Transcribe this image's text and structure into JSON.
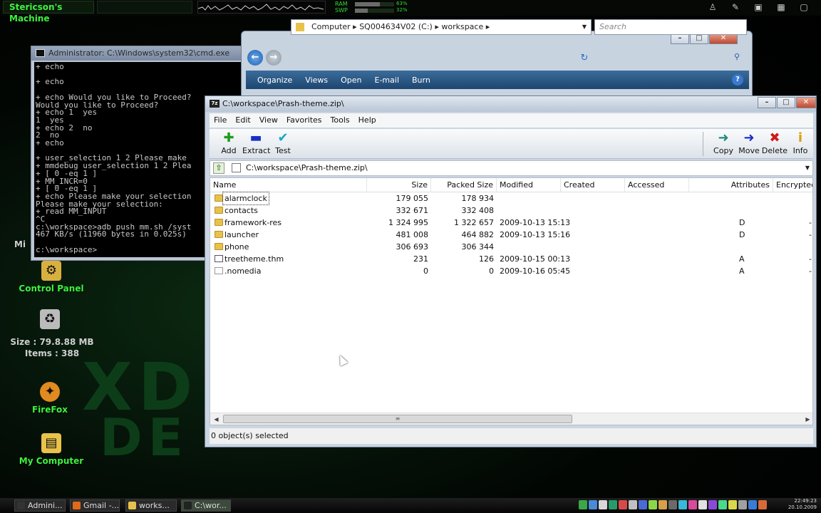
{
  "desktop": {
    "machine_name": "Stericson's Machine",
    "ram_label": "RAM",
    "swp_label": "SWP",
    "ram_value": "63%",
    "swp_value": "32%",
    "ram_fraction": 0.63,
    "swp_fraction": 0.32,
    "icons": [
      {
        "label": "Control Panel",
        "icon": "control-panel-icon"
      },
      {
        "label": "FireFox",
        "icon": "firefox-icon"
      },
      {
        "label": "My Computer",
        "icon": "my-computer-icon"
      }
    ],
    "recycle_info": {
      "size": "Size : 79.8.88 MB",
      "items": "Items : 388"
    },
    "partial_label": "Mi"
  },
  "cmd_window": {
    "title": "Administrator: C:\\Windows\\system32\\cmd.exe",
    "lines": [
      "+ echo",
      "",
      "+ echo",
      "",
      "+ echo Would you like to Proceed?",
      "Would you like to Proceed?",
      "+ echo 1  yes",
      "1  yes",
      "+ echo 2  no",
      "2  no",
      "+ echo",
      "",
      "+ user_selection 1 2 Please make",
      "+ mmdebug user_selection 1 2 Plea",
      "+ [ 0 -eq 1 ]",
      "+ MM_INCR=0",
      "+ [ 0 -eq 1 ]",
      "+ echo Please make your selection",
      "Please make your selection:",
      "+ read MM_INPUT",
      "^C",
      "c:\\workspace>adb push mm.sh /syst",
      "467 KB/s (11960 bytes in 0.025s)",
      "",
      "c:\\workspace>"
    ]
  },
  "explorer": {
    "breadcrumb": [
      "Computer",
      "SQ004634V02 (C:)",
      "workspace"
    ],
    "search_placeholder": "Search",
    "commands": [
      "Organize",
      "Views",
      "Open",
      "E-mail",
      "Burn"
    ],
    "help": "?"
  },
  "zip_window": {
    "title": "C:\\workspace\\Prash-theme.zip\\",
    "menu": [
      "File",
      "Edit",
      "View",
      "Favorites",
      "Tools",
      "Help"
    ],
    "tools_left": [
      {
        "label": "Add",
        "icon": "add-plus-icon",
        "color": "#1f9b1f"
      },
      {
        "label": "Extract",
        "icon": "extract-minus-icon",
        "color": "#1a2fc9"
      },
      {
        "label": "Test",
        "icon": "test-check-icon",
        "color": "#19a7c7"
      }
    ],
    "tools_right": [
      {
        "label": "Copy",
        "icon": "copy-arrow-icon",
        "color": "#1a8a7a"
      },
      {
        "label": "Move",
        "icon": "move-arrow-icon",
        "color": "#1a2fc9"
      },
      {
        "label": "Delete",
        "icon": "delete-x-icon",
        "color": "#d01818"
      },
      {
        "label": "Info",
        "icon": "info-icon",
        "color": "#d8a010"
      }
    ],
    "path": "C:\\workspace\\Prash-theme.zip\\",
    "columns": [
      "Name",
      "Size",
      "Packed Size",
      "Modified",
      "Created",
      "Accessed",
      "Attributes",
      "Encrypted"
    ],
    "rows": [
      {
        "name": "alarmclock",
        "type": "folder",
        "size": "179 055",
        "packed": "178 934",
        "modified": "",
        "created": "",
        "accessed": "",
        "attributes": "",
        "encrypted": ""
      },
      {
        "name": "contacts",
        "type": "folder",
        "size": "332 671",
        "packed": "332 408",
        "modified": "",
        "created": "",
        "accessed": "",
        "attributes": "",
        "encrypted": ""
      },
      {
        "name": "framework-res",
        "type": "folder",
        "size": "1 324 995",
        "packed": "1 322 657",
        "modified": "2009-10-13 15:13",
        "created": "",
        "accessed": "",
        "attributes": "D",
        "encrypted": "-"
      },
      {
        "name": "launcher",
        "type": "folder",
        "size": "481 008",
        "packed": "464 882",
        "modified": "2009-10-13 15:16",
        "created": "",
        "accessed": "",
        "attributes": "D",
        "encrypted": "-"
      },
      {
        "name": "phone",
        "type": "folder",
        "size": "306 693",
        "packed": "306 344",
        "modified": "",
        "created": "",
        "accessed": "",
        "attributes": "",
        "encrypted": ""
      },
      {
        "name": "treetheme.thm",
        "type": "thm",
        "size": "231",
        "packed": "126",
        "modified": "2009-10-15 00:13",
        "created": "",
        "accessed": "",
        "attributes": "A",
        "encrypted": "-"
      },
      {
        "name": ".nomedia",
        "type": "file",
        "size": "0",
        "packed": "0",
        "modified": "2009-10-16 05:45",
        "created": "",
        "accessed": "",
        "attributes": "A",
        "encrypted": "-"
      }
    ],
    "status": "0 object(s) selected"
  },
  "taskbar": {
    "tasks": [
      {
        "label": "Admini...",
        "icon": "cmd-icon",
        "color": "#333333"
      },
      {
        "label": "Gmail -...",
        "icon": "firefox-icon",
        "color": "#e06a1a"
      },
      {
        "label": "works...",
        "icon": "folder-icon",
        "color": "#e8c24a"
      },
      {
        "label": "C:\\wor...",
        "icon": "7zip-icon",
        "color": "#222222"
      }
    ],
    "clock_time": "22:49:23",
    "clock_date": "20.10.2009"
  }
}
